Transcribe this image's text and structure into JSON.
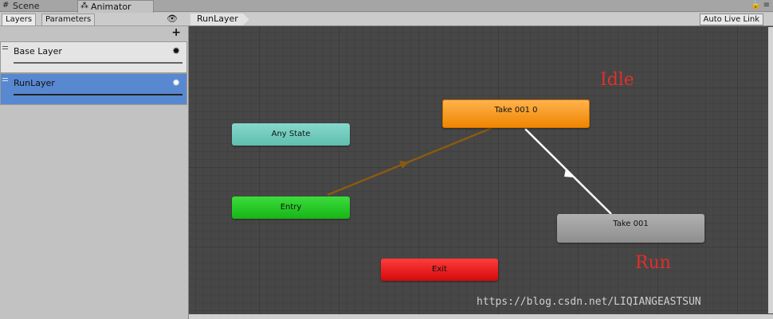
{
  "window_tabs": [
    {
      "label": "Scene",
      "icon": "grid-icon"
    },
    {
      "label": "Animator",
      "icon": "animator-icon"
    }
  ],
  "left_panel": {
    "tabs": [
      "Layers",
      "Parameters"
    ],
    "add_label": "+",
    "layers": [
      {
        "name": "Base Layer",
        "selected": false
      },
      {
        "name": "RunLayer",
        "selected": true
      }
    ]
  },
  "graph": {
    "breadcrumb": "RunLayer",
    "auto_live_link": "Auto Live Link",
    "nodes": {
      "any_state": "Any State",
      "entry": "Entry",
      "exit": "Exit",
      "take_001_0": "Take 001 0",
      "take_001": "Take 001"
    },
    "annotations": {
      "idle": "Idle",
      "run": "Run"
    },
    "watermark": "https://blog.csdn.net/LIQIANGEASTSUN"
  },
  "colors": {
    "selected_layer": "#5888d0",
    "any_state": "#6ccbbd",
    "entry": "#22c322",
    "exit": "#e01515",
    "default_state": "#f59a1f",
    "state": "#9c9c9c",
    "annotation": "#e0302a"
  }
}
